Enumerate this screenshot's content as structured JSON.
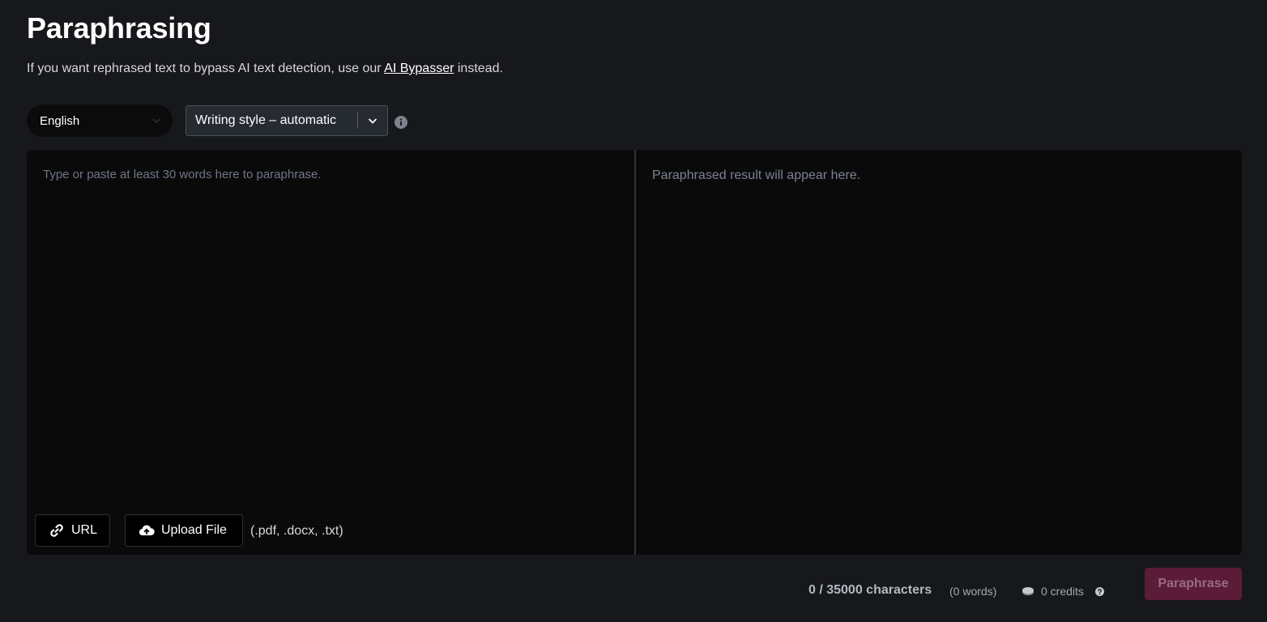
{
  "header": {
    "title": "Paraphrasing",
    "subtitle_before": "If you want rephrased text to bypass AI text detection, use our ",
    "subtitle_link": "AI Bypasser",
    "subtitle_after": " instead."
  },
  "controls": {
    "language": "English",
    "writing_style": "Writing style – automatic"
  },
  "editor": {
    "input_placeholder": "Type or paste at least 30 words here to paraphrase.",
    "result_placeholder": "Paraphrased result will appear here.",
    "url_button": "URL",
    "upload_button": "Upload File",
    "file_types": "(.pdf, .docx, .txt)"
  },
  "footer": {
    "character_count": "0 / 35000 characters",
    "word_count": "(0 words)",
    "credits": "0 credits",
    "paraphrase_button": "Paraphrase"
  },
  "colors": {
    "background": "#17181b",
    "editor_background": "#0a0a0b",
    "accent_disabled": "#5a1c37"
  },
  "icons": {
    "language_chevron": "chevron-down-icon",
    "style_chevron": "chevron-down-icon",
    "info": "info-icon",
    "url": "link-icon",
    "upload": "cloud-upload-icon",
    "credits": "coin-icon",
    "help": "help-icon"
  }
}
